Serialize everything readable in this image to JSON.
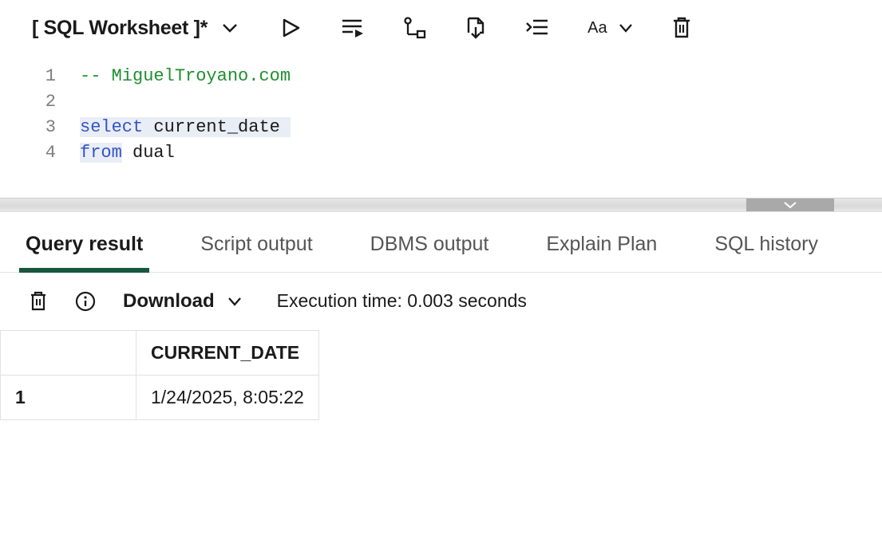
{
  "toolbar": {
    "title": "[ SQL Worksheet ]*",
    "font_label": "Aa"
  },
  "editor": {
    "lines": [
      {
        "n": "1",
        "tokens": [
          {
            "t": "-- MiguelTroyano.com",
            "cls": "tok-comment"
          }
        ]
      },
      {
        "n": "2",
        "tokens": []
      },
      {
        "n": "3",
        "tokens": [
          {
            "t": "select",
            "cls": "tok-keyword",
            "hl": true
          },
          {
            "t": " ",
            "cls": "",
            "hl": true
          },
          {
            "t": "current_date",
            "cls": "tok-ident",
            "hl": true
          },
          {
            "t": " ",
            "cls": "",
            "hl": true
          }
        ]
      },
      {
        "n": "4",
        "tokens": [
          {
            "t": "from",
            "cls": "tok-keyword",
            "hl": true
          },
          {
            "t": " ",
            "cls": ""
          },
          {
            "t": "dual",
            "cls": "tok-ident"
          }
        ]
      }
    ]
  },
  "tabs": [
    {
      "label": "Query result",
      "active": true
    },
    {
      "label": "Script output",
      "active": false
    },
    {
      "label": "DBMS output",
      "active": false
    },
    {
      "label": "Explain Plan",
      "active": false
    },
    {
      "label": "SQL history",
      "active": false
    }
  ],
  "results": {
    "download_label": "Download",
    "exec_time_label": "Execution time: 0.003 seconds",
    "columns": [
      "CURRENT_DATE"
    ],
    "rows": [
      {
        "n": "1",
        "cells": [
          "1/24/2025, 8:05:22"
        ]
      }
    ]
  }
}
